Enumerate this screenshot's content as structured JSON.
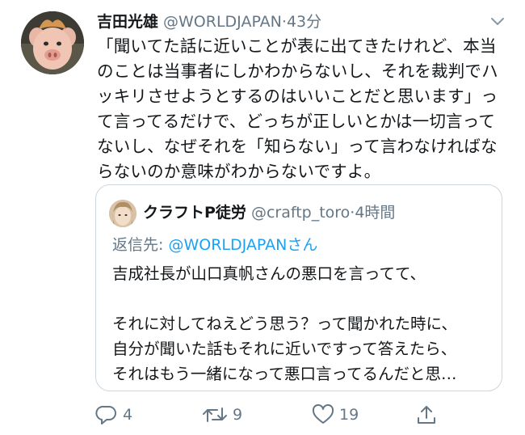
{
  "tweet": {
    "display_name": "吉田光雄",
    "handle": "@WORLDJAPAN",
    "time": "43分",
    "text": "「聞いてた話に近いことが表に出てきたけれど、本当のことは当事者にしかわからないし、それを裁判でハッキリさせようとするのはいいことだと思います」って言ってるだけで、どっちが正しいとかは一切言ってないし、なぜそれを「知らない」って言わなければならないのか意味がわからないですよ。"
  },
  "quoted": {
    "display_name": "クラフトP徒労",
    "handle": "@craftp_toro",
    "time": "4時間",
    "reply_prefix": "返信先:",
    "reply_to": "@WORLDJAPANさん",
    "lines": [
      "吉成社長が山口真帆さんの悪口を言ってて、",
      "",
      "それに対してねえどう思う？って聞かれた時に、",
      "自分が聞いた話もそれに近いですって答えたら、",
      "それはもう一緒になって悪口言ってるんだと思…"
    ]
  },
  "actions": {
    "reply_count": "4",
    "retweet_count": "9",
    "like_count": "19"
  },
  "icons": {
    "reply": "reply-icon",
    "retweet": "retweet-icon",
    "like": "heart-icon",
    "share": "share-icon",
    "caret": "chevron-down-icon"
  },
  "colors": {
    "text": "#14171a",
    "secondary": "#657786",
    "link": "#1da1f2",
    "border": "#ccd6dd"
  }
}
